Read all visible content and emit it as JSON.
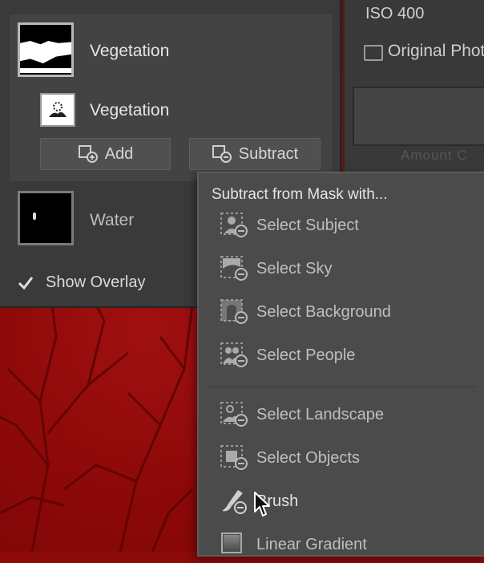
{
  "info_panel": {
    "iso": "ISO 400",
    "original_photo": "Original Phot",
    "faded_text": "Amount C"
  },
  "masks": {
    "groups": [
      {
        "label": "Vegetation",
        "component_label": "Vegetation"
      },
      {
        "label": "Water"
      }
    ],
    "add_label": "Add",
    "subtract_label": "Subtract",
    "show_overlay": "Show Overlay",
    "show_overlay_checked": true
  },
  "subtract_menu": {
    "title": "Subtract from Mask with...",
    "items": [
      {
        "label": "Select Subject",
        "icon": "select-subject-icon"
      },
      {
        "label": "Select Sky",
        "icon": "select-sky-icon"
      },
      {
        "label": "Select Background",
        "icon": "select-background-icon"
      },
      {
        "label": "Select People",
        "icon": "select-people-icon"
      },
      {
        "label": "Select Landscape",
        "icon": "select-landscape-icon"
      },
      {
        "label": "Select Objects",
        "icon": "select-objects-icon"
      },
      {
        "label": "Brush",
        "icon": "brush-icon"
      },
      {
        "label": "Linear Gradient",
        "icon": "linear-gradient-icon"
      }
    ]
  },
  "colors": {
    "panel_bg": "#3a3a3a",
    "menu_bg": "#4b4b4b",
    "overlay_red": "#8c0a0a"
  }
}
